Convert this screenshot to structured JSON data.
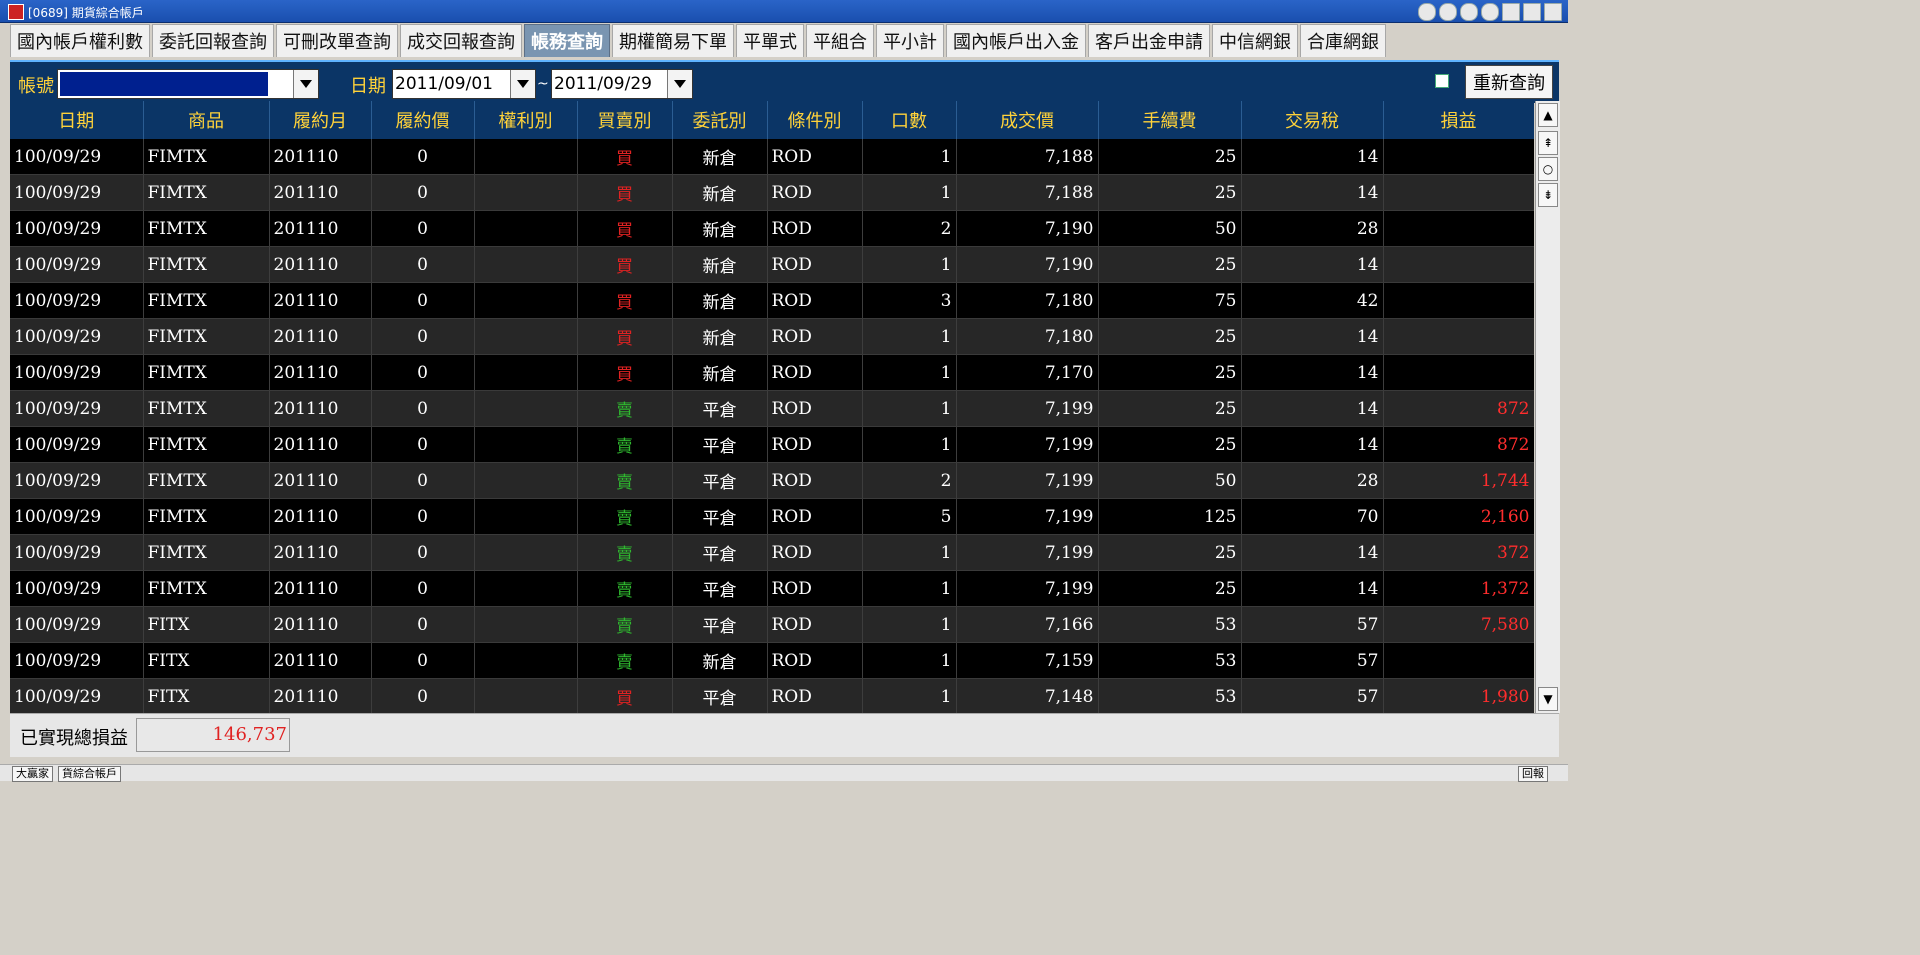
{
  "window": {
    "title": "[0689] 期貨綜合帳戶"
  },
  "tabs": [
    {
      "label": "國內帳戶權利數"
    },
    {
      "label": "委託回報查詢"
    },
    {
      "label": "可刪改單查詢"
    },
    {
      "label": "成交回報查詢"
    },
    {
      "label": "帳務查詢",
      "active": true
    },
    {
      "label": "期權簡易下單"
    },
    {
      "label": "平單式"
    },
    {
      "label": "平組合"
    },
    {
      "label": "平小計"
    },
    {
      "label": "國內帳戶出入金"
    },
    {
      "label": "客戶出金申請"
    },
    {
      "label": "中信網銀"
    },
    {
      "label": "合庫網銀"
    }
  ],
  "filters": {
    "account_label": "帳號",
    "date_label": "日期",
    "date_from": "2011/09/01",
    "tilde": "~",
    "date_to": "2011/09/29",
    "requery_label": "重新查詢"
  },
  "table": {
    "headers": [
      "日期",
      "商品",
      "履約月",
      "履約價",
      "權利別",
      "買賣別",
      "委託別",
      "條件別",
      "口數",
      "成交價",
      "手續費",
      "交易稅",
      "損益"
    ],
    "rows": [
      [
        "100/09/29",
        "FIMTX",
        "201110",
        "0",
        "",
        "買",
        "新倉",
        "ROD",
        "1",
        "7,188",
        "25",
        "14",
        ""
      ],
      [
        "100/09/29",
        "FIMTX",
        "201110",
        "0",
        "",
        "買",
        "新倉",
        "ROD",
        "1",
        "7,188",
        "25",
        "14",
        ""
      ],
      [
        "100/09/29",
        "FIMTX",
        "201110",
        "0",
        "",
        "買",
        "新倉",
        "ROD",
        "2",
        "7,190",
        "50",
        "28",
        ""
      ],
      [
        "100/09/29",
        "FIMTX",
        "201110",
        "0",
        "",
        "買",
        "新倉",
        "ROD",
        "1",
        "7,190",
        "25",
        "14",
        ""
      ],
      [
        "100/09/29",
        "FIMTX",
        "201110",
        "0",
        "",
        "買",
        "新倉",
        "ROD",
        "3",
        "7,180",
        "75",
        "42",
        ""
      ],
      [
        "100/09/29",
        "FIMTX",
        "201110",
        "0",
        "",
        "買",
        "新倉",
        "ROD",
        "1",
        "7,180",
        "25",
        "14",
        ""
      ],
      [
        "100/09/29",
        "FIMTX",
        "201110",
        "0",
        "",
        "買",
        "新倉",
        "ROD",
        "1",
        "7,170",
        "25",
        "14",
        ""
      ],
      [
        "100/09/29",
        "FIMTX",
        "201110",
        "0",
        "",
        "賣",
        "平倉",
        "ROD",
        "1",
        "7,199",
        "25",
        "14",
        "872"
      ],
      [
        "100/09/29",
        "FIMTX",
        "201110",
        "0",
        "",
        "賣",
        "平倉",
        "ROD",
        "1",
        "7,199",
        "25",
        "14",
        "872"
      ],
      [
        "100/09/29",
        "FIMTX",
        "201110",
        "0",
        "",
        "賣",
        "平倉",
        "ROD",
        "2",
        "7,199",
        "50",
        "28",
        "1,744"
      ],
      [
        "100/09/29",
        "FIMTX",
        "201110",
        "0",
        "",
        "賣",
        "平倉",
        "ROD",
        "5",
        "7,199",
        "125",
        "70",
        "2,160"
      ],
      [
        "100/09/29",
        "FIMTX",
        "201110",
        "0",
        "",
        "賣",
        "平倉",
        "ROD",
        "1",
        "7,199",
        "25",
        "14",
        "372"
      ],
      [
        "100/09/29",
        "FIMTX",
        "201110",
        "0",
        "",
        "賣",
        "平倉",
        "ROD",
        "1",
        "7,199",
        "25",
        "14",
        "1,372"
      ],
      [
        "100/09/29",
        "FITX",
        "201110",
        "0",
        "",
        "賣",
        "平倉",
        "ROD",
        "1",
        "7,166",
        "53",
        "57",
        "7,580"
      ],
      [
        "100/09/29",
        "FITX",
        "201110",
        "0",
        "",
        "賣",
        "新倉",
        "ROD",
        "1",
        "7,159",
        "53",
        "57",
        ""
      ],
      [
        "100/09/29",
        "FITX",
        "201110",
        "0",
        "",
        "買",
        "平倉",
        "ROD",
        "1",
        "7,148",
        "53",
        "57",
        "1,980"
      ]
    ]
  },
  "footer": {
    "label": "已實現總損益",
    "value": "146,737"
  },
  "taskbar": {
    "items": [
      "大贏家",
      "貨綜合帳戶"
    ],
    "right_label": "回報"
  },
  "colors": {
    "buy": "#e02222",
    "sell": "#2fb82f",
    "header_bg": "#0b3566",
    "header_text": "#ffd23a"
  },
  "icons": [
    "app-icon",
    "dropdown-arrow-icon",
    "scroll-up-icon",
    "scroll-top-icon",
    "scroll-circle-icon",
    "scroll-down-icon"
  ]
}
